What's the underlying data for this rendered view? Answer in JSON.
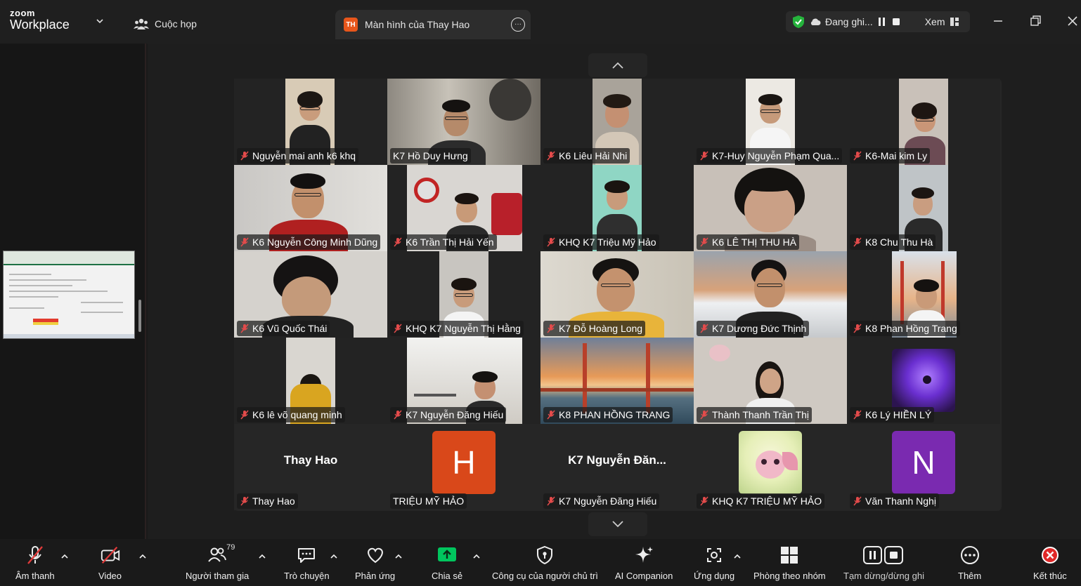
{
  "app": {
    "brand_top": "zoom",
    "brand_bottom": "Workplace",
    "meetings_label": "Cuộc họp",
    "share_tab_badge": "TH",
    "share_tab_title": "Màn hình của Thay Hao",
    "recording_status": "Đang ghi...",
    "view_label": "Xem",
    "accent": "#2d8cff",
    "share_green": "#00c65e",
    "end_red": "#e02828"
  },
  "participants": [
    {
      "name": "Nguyễn mai anh k6 khq",
      "muted": true
    },
    {
      "name": "K7 Hồ Duy Hưng",
      "muted": false
    },
    {
      "name": "K6 Liêu Hải Nhi",
      "muted": true
    },
    {
      "name": "K7-Huy Nguyễn Phạm Qua...",
      "muted": true
    },
    {
      "name": "K6-Mai kim Ly",
      "muted": true
    },
    {
      "name": "K6 Nguyễn Công Minh Dũng",
      "muted": true
    },
    {
      "name": "K6 Trần Thị Hải Yến",
      "muted": true
    },
    {
      "name": "KHQ K7 Triệu Mỹ Hảo",
      "muted": true
    },
    {
      "name": "K6 LÊ THỊ THU HÀ",
      "muted": true
    },
    {
      "name": "K8 Chu Thu Hà",
      "muted": true
    },
    {
      "name": "K6 Vũ Quốc Thái",
      "muted": true
    },
    {
      "name": "KHQ K7 Nguyễn Thị Hằng",
      "muted": true
    },
    {
      "name": "K7 Đỗ Hoàng Long",
      "muted": true
    },
    {
      "name": "K7 Dương Đức Thịnh",
      "muted": true
    },
    {
      "name": "K8 Phan Hồng Trang",
      "muted": true
    },
    {
      "name": "K6 lê võ quang minh",
      "muted": true
    },
    {
      "name": "K7 Nguyễn Đăng Hiếu",
      "muted": true
    },
    {
      "name": "K8 PHAN HỒNG TRANG",
      "muted": true
    },
    {
      "name": "Thành Thanh Trần Thị",
      "muted": true
    },
    {
      "name": "K6 Lý HIỀN LÝ",
      "muted": true
    },
    {
      "name": "Thay Hao",
      "muted": true,
      "display_name": "Thay Hao"
    },
    {
      "name": "TRIỆU MỸ HẢO",
      "muted": false,
      "avatar_letter": "H",
      "avatar_color": "#d9481a"
    },
    {
      "name": "K7 Nguyễn Đăng Hiếu",
      "muted": true,
      "display_name": "K7  Nguyễn Đăn..."
    },
    {
      "name": "KHQ K7 TRIỆU MỸ HẢO",
      "muted": true
    },
    {
      "name": "Văn Thanh Nghị",
      "muted": true,
      "avatar_letter": "N",
      "avatar_color": "#7a2ab0"
    }
  ],
  "toolbar": {
    "audio": "Âm thanh",
    "video": "Video",
    "participants": "Người tham gia",
    "participants_count": "79",
    "chat": "Trò chuyện",
    "reactions": "Phản ứng",
    "share": "Chia sẻ",
    "host_tools": "Công cụ của người chủ trì",
    "ai_companion": "AI Companion",
    "apps": "Ứng dụng",
    "breakout": "Phòng theo nhóm",
    "pause_stop_rec": "Tạm dừng/dừng ghi",
    "more": "Thêm",
    "end": "Kết thúc"
  }
}
